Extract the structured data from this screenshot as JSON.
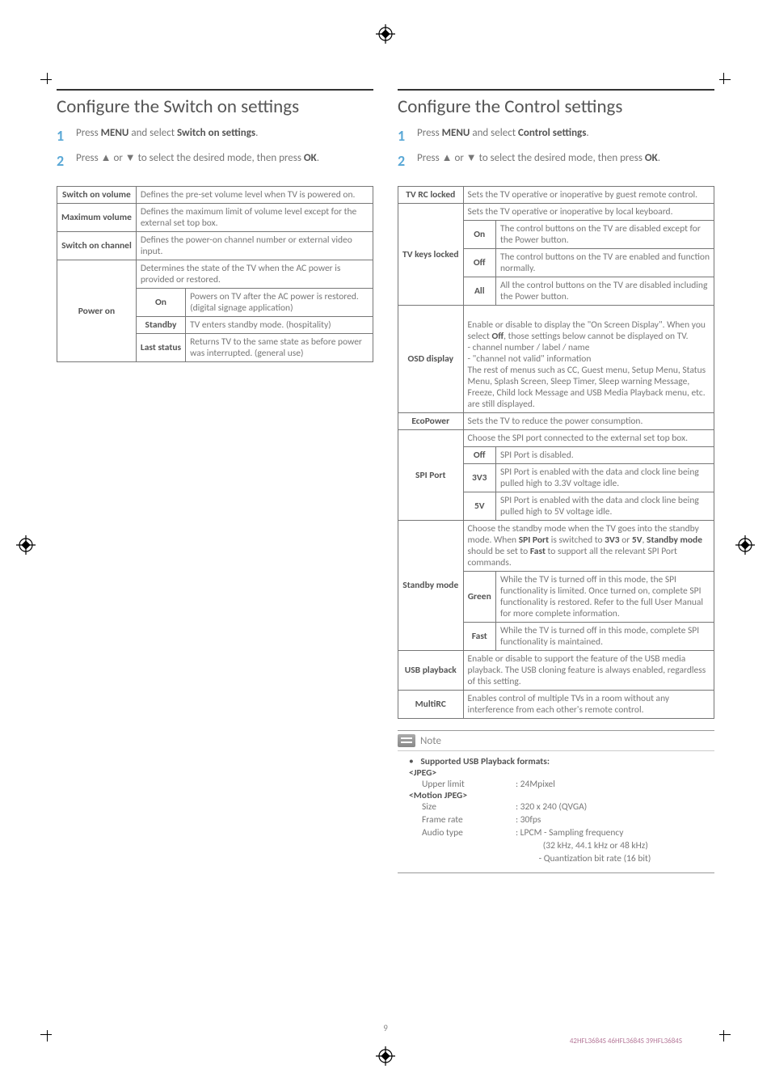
{
  "left": {
    "heading": "Configure the Switch on settings",
    "steps": [
      {
        "num": "1",
        "pre": "Press ",
        "b1": "MENU",
        "mid": " and select ",
        "b2": "Switch on settings",
        "post": "."
      },
      {
        "num": "2",
        "pre": "Press ▲ or ▼ to select the desired mode, then press ",
        "b1": "OK",
        "mid": "",
        "b2": "",
        "post": "."
      }
    ],
    "rows": {
      "switch_on_volume": {
        "head": "Switch on volume",
        "desc": "Defines the pre-set volume level when TV is powered on."
      },
      "maximum_volume": {
        "head": "Maximum volume",
        "desc": "Defines the maximum limit of volume level except for the external set top box."
      },
      "switch_on_channel": {
        "head": "Switch on channel",
        "desc": "Defines the power-on channel number or external video input."
      },
      "power_on": {
        "head": "Power on",
        "intro": "Determines the state of the TV when the AC power is provided or restored.",
        "options": [
          {
            "name": "On",
            "desc": "Powers on TV after the AC power is restored. (digital signage application)"
          },
          {
            "name": "Standby",
            "desc": "TV enters standby mode. (hospitality)"
          },
          {
            "name": "Last status",
            "desc": "Returns TV to the same state as before power was interrupted. (general use)"
          }
        ]
      }
    }
  },
  "right": {
    "heading": "Configure the Control settings",
    "steps": [
      {
        "num": "1",
        "pre": "Press ",
        "b1": "MENU",
        "mid": " and select ",
        "b2": "Control settings",
        "post": "."
      },
      {
        "num": "2",
        "pre": "Press ▲ or ▼ to select the desired mode, then press ",
        "b1": "OK",
        "mid": "",
        "b2": "",
        "post": "."
      }
    ],
    "rows": {
      "tv_rc_locked": {
        "head": "TV RC locked",
        "desc": "Sets the TV operative or inoperative by guest remote control."
      },
      "tv_keys_locked": {
        "head": "TV keys locked",
        "intro": "Sets the TV operative or inoperative by local keyboard.",
        "options": [
          {
            "name": "On",
            "desc": "The control buttons on the TV are disabled except for the Power button."
          },
          {
            "name": "Off",
            "desc": "The control buttons on the TV are enabled and function normally."
          },
          {
            "name": "All",
            "desc": "All the control buttons on the TV are disabled including the Power button."
          }
        ]
      },
      "osd_display": {
        "head": "OSD display",
        "desc_pre": "Enable or disable to display the \"On Screen Display\". When you select ",
        "desc_b": "Off",
        "desc_post": ", those settings below cannot be displayed on TV.\n- channel number / label / name\n- \"channel not valid\" information\nThe rest of menus such as CC, Guest menu, Setup Menu, Status Menu, Splash Screen, Sleep Timer, Sleep warning Message, Freeze, Child lock Message and USB Media Playback menu, etc. are still displayed."
      },
      "ecopower": {
        "head": "EcoPower",
        "desc": "Sets the TV to reduce the power consumption."
      },
      "spi_port": {
        "head": "SPI Port",
        "intro": "Choose the SPI port connected to the external set top box.",
        "options": [
          {
            "name": "Off",
            "desc": "SPI Port is disabled."
          },
          {
            "name": "3V3",
            "desc": "SPI Port is enabled with the data and clock line being pulled high to 3.3V voltage idle."
          },
          {
            "name": "5V",
            "desc": "SPI Port is enabled with the data and clock line being pulled high to 5V voltage idle."
          }
        ]
      },
      "standby_mode": {
        "head": "Standby mode",
        "intro_pre": "Choose the standby mode when the TV goes into the standby mode. When ",
        "intro_b1": "SPI Port",
        "intro_mid1": " is switched to ",
        "intro_b2": "3V3",
        "intro_mid2": " or ",
        "intro_b3": "5V",
        "intro_mid3": ", ",
        "intro_b4": "Standby mode",
        "intro_mid4": " should be set to ",
        "intro_b5": "Fast",
        "intro_post": " to support all the relevant SPI Port commands.",
        "options": [
          {
            "name": "Green",
            "desc": "While the TV is turned off in this mode, the SPI functionality is limited. Once turned on, complete SPI functionality is restored. Refer to the full User Manual for more complete information."
          },
          {
            "name": "Fast",
            "desc": "While the TV is turned off in this mode, complete SPI functionality is maintained."
          }
        ]
      },
      "usb_playback": {
        "head": "USB playback",
        "desc": "Enable or disable to support the feature of the USB media playback. The USB cloning feature is always enabled, regardless of this setting."
      },
      "multirc": {
        "head": "MultiRC",
        "desc": "Enables control of multiple TVs in a room without any interference from each other's remote control."
      }
    },
    "note": {
      "title": "Note",
      "lead": "Supported USB Playback formats:",
      "jpeg_head": "<JPEG>",
      "jpeg_k": "Upper limit",
      "jpeg_v": ": 24Mpixel",
      "mjpeg_head": "<Motion JPEG>",
      "kv": [
        {
          "k": "Size",
          "v": ": 320 x 240 (QVGA)"
        },
        {
          "k": "Frame rate",
          "v": ": 30fps"
        },
        {
          "k": "Audio type",
          "v": ": LPCM - Sampling frequency"
        },
        {
          "k": "",
          "v": "             (32 kHz, 44.1 kHz or 48 kHz)"
        },
        {
          "k": "",
          "v": "           - Quantization bit rate (16 bit)"
        }
      ]
    }
  },
  "footer": {
    "page": "9",
    "models": "42HFL3684S  46HFL3684S  39HFL3684S"
  }
}
